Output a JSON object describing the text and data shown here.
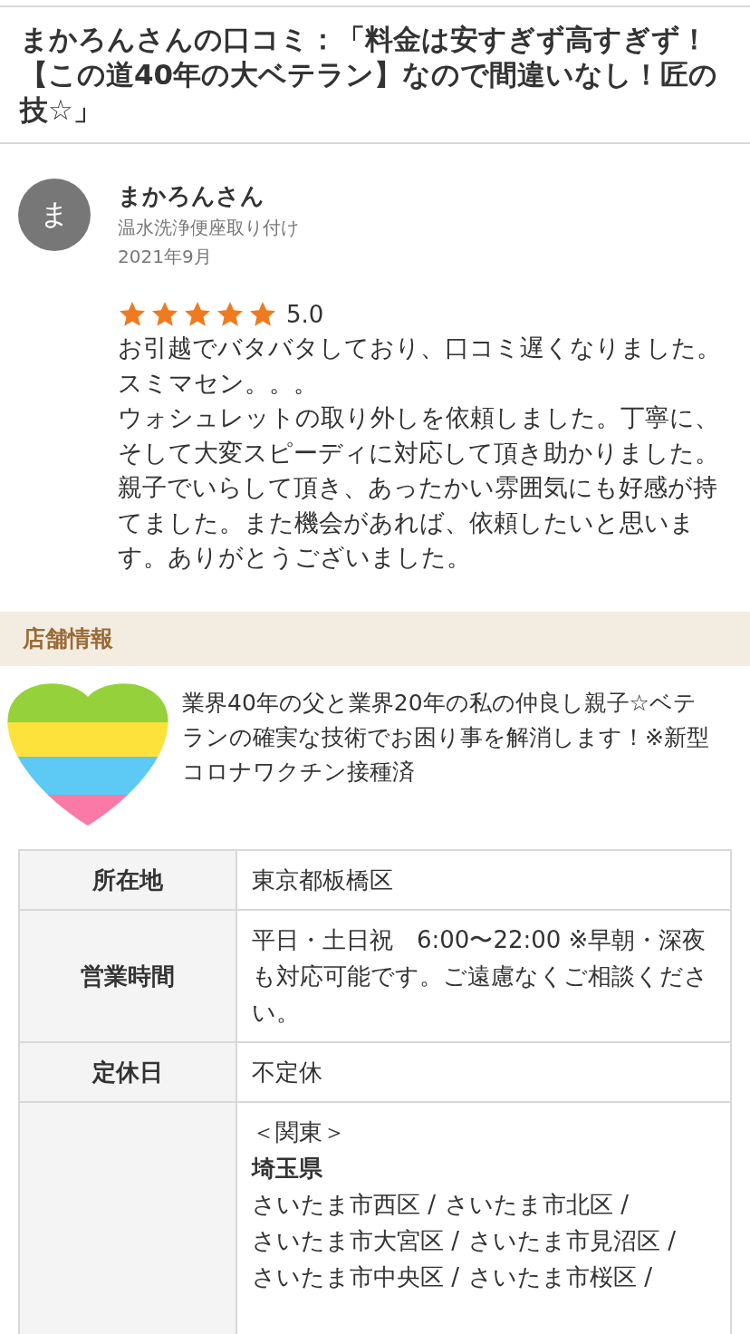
{
  "page_title": "まかろんさんの口コミ：「料金は安すぎず高すぎず！【この道40年の大ベテラン】なので間違いなし！匠の技☆」",
  "review": {
    "avatar_letter": "ま",
    "reviewer": "まかろんさん",
    "service": "温水洗浄便座取り付け",
    "date": "2021年9月",
    "stars": 5,
    "rating": "5.0",
    "body": [
      "お引越でバタバタしており、口コミ遅くなりました。スミマセン。。。",
      "ウォシュレットの取り外しを依頼しました。丁寧に、そして大変スピーディに対応して頂き助かりました。親子でいらして頂き、あったかい雰囲気にも好感が持てました。また機会があれば、依頼したいと思います。ありがとうございました。"
    ]
  },
  "shop_info": {
    "heading": "店舗情報",
    "intro": "業界40年の父と業界20年の私の仲良し親子☆ベテランの確実な技術でお困り事を解消します！※新型コロナワクチン接種済",
    "rows": [
      {
        "kind": "text",
        "label": "所在地",
        "value": "東京都板橋区"
      },
      {
        "kind": "text",
        "label": "営業時間",
        "value": "平日・土日祝　6:00〜22:00 ※早朝・深夜も対応可能です。ご遠慮なくご相談ください。"
      },
      {
        "kind": "text",
        "label": "定休日",
        "value": "不定休"
      },
      {
        "kind": "areas",
        "region": "＜関東＞",
        "prefecture": "埼玉県",
        "cities": [
          "さいたま市西区 /",
          "さいたま市北区 /",
          "さいたま市大宮区 /",
          "さいたま市見沼区 /",
          "さいたま市中央区 /",
          "さいたま市桜区 /"
        ]
      }
    ]
  }
}
